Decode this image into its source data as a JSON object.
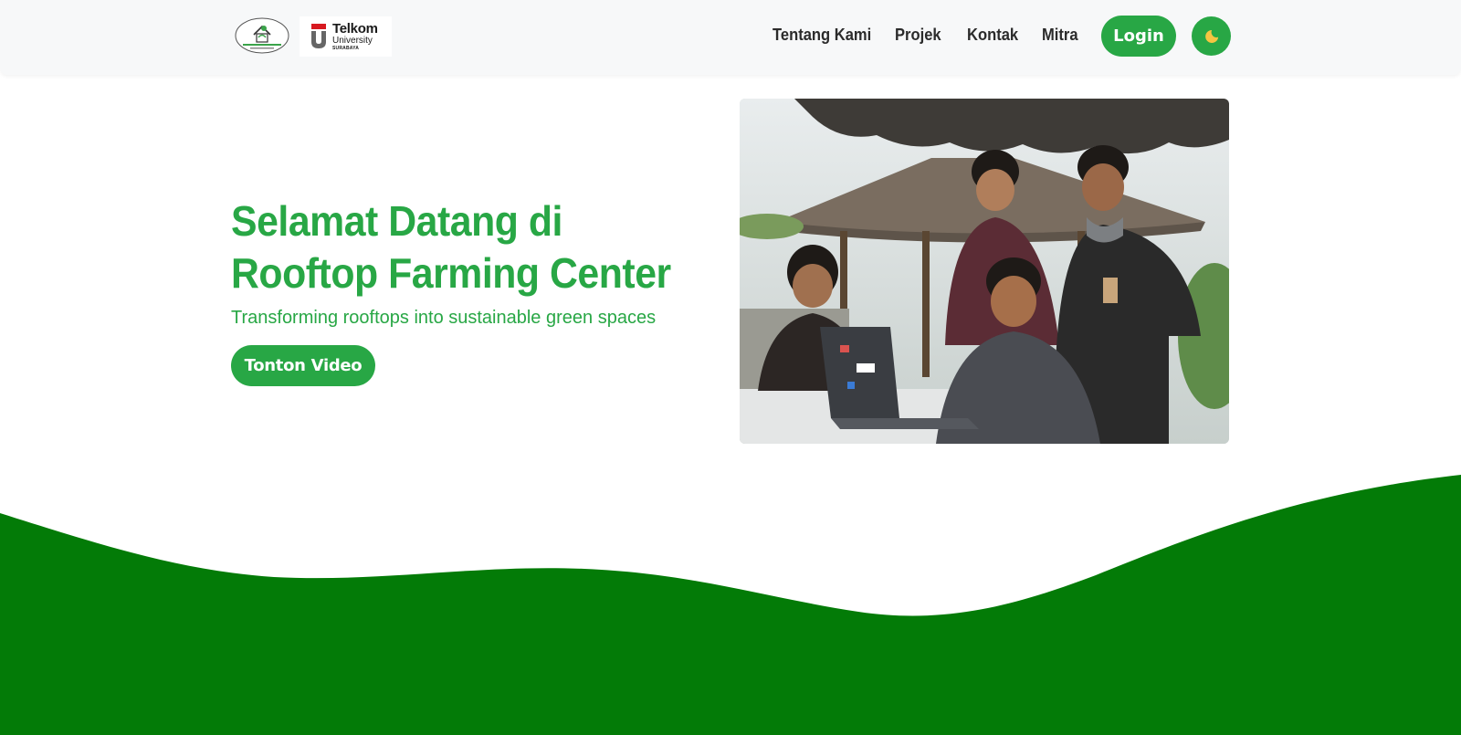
{
  "navbar": {
    "logo_rfc_alt": "Rooftop Farming Center logo",
    "logo_telkom": {
      "name": "Telkom",
      "university": "University",
      "city": "SURABAYA"
    },
    "links": [
      {
        "label": "Tentang Kami"
      },
      {
        "label": "Projek"
      },
      {
        "label": "Kontak"
      },
      {
        "label": "Mitra"
      }
    ],
    "login_label": "Login",
    "theme_toggle_icon": "moon-icon"
  },
  "hero": {
    "title": "Selamat Datang di Rooftop Farming Center",
    "subtitle": "Transforming rooftops into sustainable green spaces",
    "video_button_label": "Tonton Video",
    "photo_alt": "Team photo on rooftop"
  },
  "colors": {
    "accent": "#28a745",
    "wave": "#037b07",
    "navbar_bg": "#f7f8f9"
  }
}
